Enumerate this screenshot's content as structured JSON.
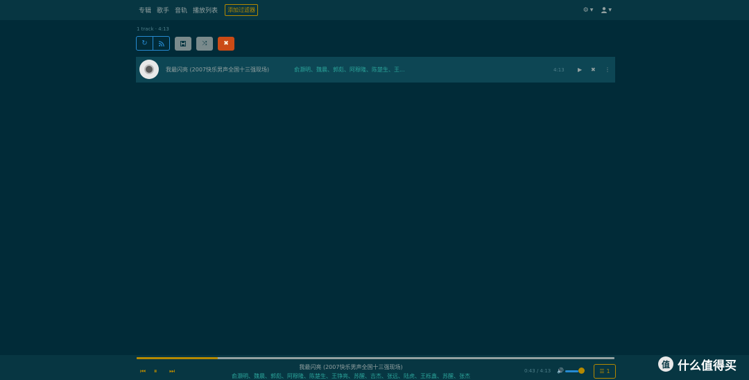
{
  "nav": {
    "links": [
      "专辑",
      "歌手",
      "音轨",
      "播放列表"
    ],
    "filter_button": "添加过滤器",
    "settings_icon": "gears-icon",
    "user_icon": "user-icon"
  },
  "summary": "1 track · 4:13",
  "toolbar": {
    "buttons": [
      "refresh-icon",
      "rss-icon",
      "save-icon",
      "shuffle-icon",
      "clear-icon"
    ]
  },
  "tracks": [
    {
      "title": "我最闪亮 (2007快乐男声全国十三强现场)",
      "artists": "俞灏明、魏晨、郭彪、阿穆隆、陈楚生、王...",
      "duration": "4:13"
    }
  ],
  "player": {
    "title": "我最闪亮 (2007快乐男声全国十三强现场)",
    "artists": "俞灏明、魏晨、郭彪、阿穆隆、陈楚生、王铮亮、苏醒、吉杰、张远、陆虎、王栎鑫、苏醒、张杰",
    "time": "0:43 / 4:13",
    "progress": 0.17,
    "volume": 0.7,
    "queue_count": "1"
  },
  "watermark": {
    "badge": "值",
    "text": "什么值得买"
  },
  "colors": {
    "background": "#012b38",
    "accent": "#b58900",
    "link": "#2aa198",
    "blue": "#268bd2",
    "danger": "#cb4b16"
  }
}
